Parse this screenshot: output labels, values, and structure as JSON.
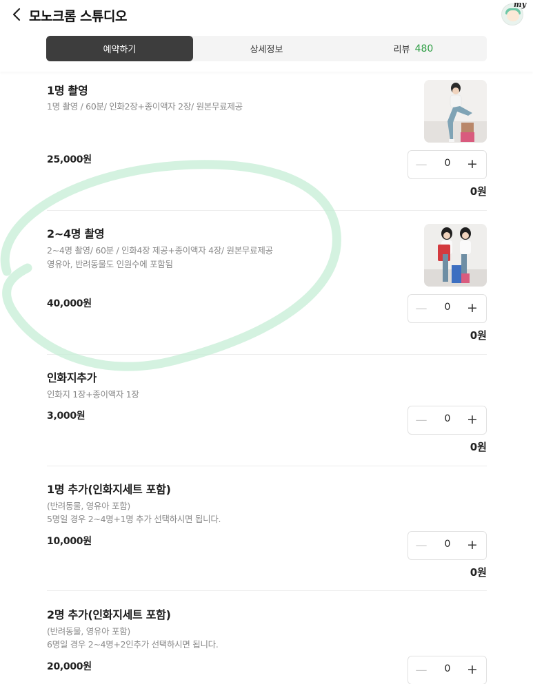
{
  "header": {
    "title": "모노크롬 스튜디오",
    "back_icon": "chevron-left-icon",
    "avatar_label": "my"
  },
  "tabs": [
    {
      "label": "예약하기",
      "active": true
    },
    {
      "label": "상세정보",
      "active": false
    },
    {
      "label": "리뷰",
      "count": "480",
      "active": false
    }
  ],
  "items": [
    {
      "title": "1명 촬영",
      "desc1": "1명 촬영 / 60분/ 인화2장+종이액자 2장/ 원본무료제공",
      "desc2": "",
      "price": "25,000원",
      "quantity": "0",
      "total": "0원",
      "has_thumb": true
    },
    {
      "title": "2~4명 촬영",
      "desc1": "2~4명 촬영/ 60분 / 인화4장 제공+종이액자 4장/ 원본무료제공",
      "desc2": "영유아, 반려동물도 인원수에 포함됨",
      "price": "40,000원",
      "quantity": "0",
      "total": "0원",
      "has_thumb": true
    },
    {
      "title": "인화지추가",
      "desc1": "인화지 1장+종이액자 1장",
      "desc2": "",
      "price": "3,000원",
      "quantity": "0",
      "total": "0원",
      "has_thumb": false
    },
    {
      "title": "1명 추가(인화지세트 포함)",
      "desc1": "(반려동물, 영유아 포함)",
      "desc2": "5명일 경우 2~4명+1명 추가 선택하시면 됩니다.",
      "price": "10,000원",
      "quantity": "0",
      "total": "0원",
      "has_thumb": false
    },
    {
      "title": "2명 추가(인화지세트 포함)",
      "desc1": "(반려동물, 영유아 포함)",
      "desc2": "6명일 경우 2~4명+2인추가 선택하시면 됩니다.",
      "price": "20,000원",
      "quantity": "0",
      "total": "",
      "has_thumb": false
    }
  ],
  "colors": {
    "active_tab": "#3d3d3d",
    "review_count": "#2f9e45",
    "annotation": "#c6eed6"
  }
}
